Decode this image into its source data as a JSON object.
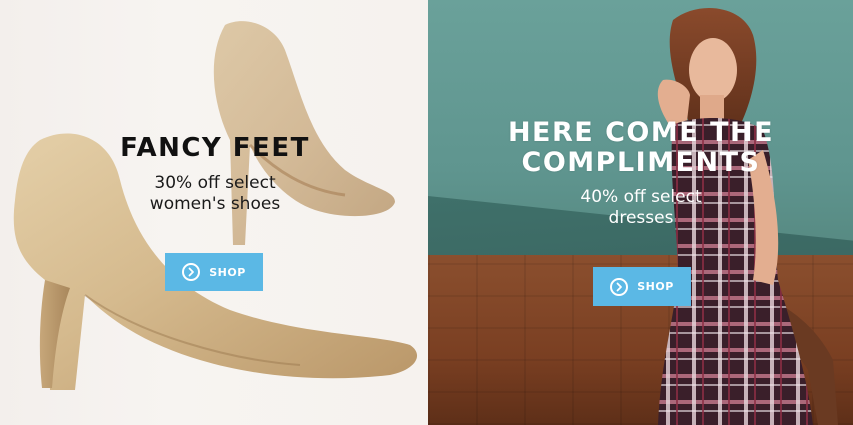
{
  "left_promo": {
    "headline": "FANCY FEET",
    "subline_1": "30% off select",
    "subline_2": "women's shoes",
    "button_label": "SHOP"
  },
  "right_promo": {
    "headline_1": "HERE COME THE",
    "headline_2": "COMPLIMENTS",
    "subline_1": "40% off select",
    "subline_2": "dresses",
    "button_label": "SHOP"
  },
  "icons": {
    "shop_button_icon": "chevron-circle-right-icon"
  },
  "colors": {
    "button_bg": "#5bb8e5",
    "left_headline": "#111111",
    "right_headline": "#ffffff"
  }
}
